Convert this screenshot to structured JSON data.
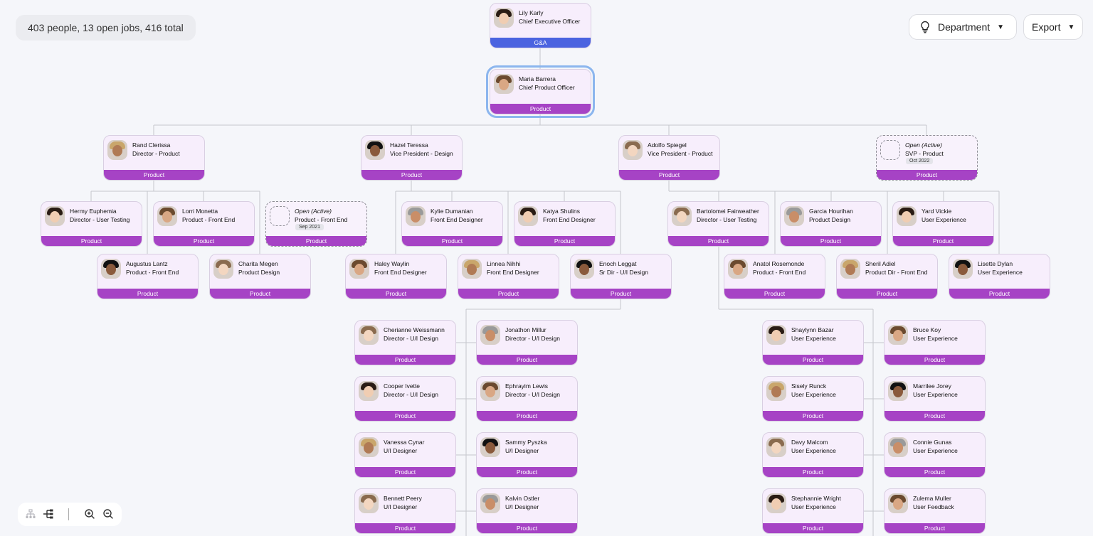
{
  "summary": "403 people, 13 open jobs, 416 total",
  "controls": {
    "department_label": "Department",
    "department_icon": "lightbulb-icon",
    "export_label": "Export"
  },
  "colors": {
    "product": "#a643c5",
    "ga": "#4b63e0"
  },
  "cards": [
    {
      "name": "Lily Karly",
      "title": "Chief Executive Officer",
      "dept": "G&A"
    },
    {
      "name": "Maria Barrera",
      "title": "Chief Product Officer",
      "dept": "Product"
    },
    {
      "name": "Rand Clerissa",
      "title": "Director - Product",
      "dept": "Product"
    },
    {
      "name": "Hazel Teressa",
      "title": "Vice President - Design",
      "dept": "Product"
    },
    {
      "name": "Adolfo Spiegel",
      "title": "Vice President - Product",
      "dept": "Product"
    },
    {
      "name": "Open (Active)",
      "title": "SVP - Product",
      "dept": "Product",
      "date": "Oct 2022"
    },
    {
      "name": "Hermy Euphemia",
      "title": "Director - User Testing",
      "dept": "Product"
    },
    {
      "name": "Lorri Monetta",
      "title": "Product - Front End",
      "dept": "Product"
    },
    {
      "name": "Open (Active)",
      "title": "Product - Front End",
      "dept": "Product",
      "date": "Sep 2021"
    },
    {
      "name": "Augustus Lantz",
      "title": "Product - Front End",
      "dept": "Product"
    },
    {
      "name": "Charita Megen",
      "title": "Product Design",
      "dept": "Product"
    },
    {
      "name": "Kylie Dumanian",
      "title": "Front End Designer",
      "dept": "Product"
    },
    {
      "name": "Katya Shulins",
      "title": "Front End Designer",
      "dept": "Product"
    },
    {
      "name": "Haley Waylin",
      "title": "Front End Designer",
      "dept": "Product"
    },
    {
      "name": "Linnea Nihhi",
      "title": "Front End Designer",
      "dept": "Product"
    },
    {
      "name": "Enoch Leggat",
      "title": "Sr Dir - U/I Design",
      "dept": "Product"
    },
    {
      "name": "Bartolomei Fairweather",
      "title": "Director - User Testing",
      "dept": "Product"
    },
    {
      "name": "Garcia Hourihan",
      "title": "Product Design",
      "dept": "Product"
    },
    {
      "name": "Yard Vickie",
      "title": "User Experience",
      "dept": "Product"
    },
    {
      "name": "Anatol Rosemonde",
      "title": "Product - Front End",
      "dept": "Product"
    },
    {
      "name": "Sheril Adiel",
      "title": "Product Dir - Front End",
      "dept": "Product"
    },
    {
      "name": "Lisette Dylan",
      "title": "User Experience",
      "dept": "Product"
    },
    {
      "name": "Cherianne Weissmann",
      "title": "Director - U/I Design",
      "dept": "Product"
    },
    {
      "name": "Jonathon Millur",
      "title": "Director - U/I Design",
      "dept": "Product"
    },
    {
      "name": "Cooper Ivette",
      "title": "Director - U/I Design",
      "dept": "Product"
    },
    {
      "name": "Ephrayim Lewis",
      "title": "Director - U/I Design",
      "dept": "Product"
    },
    {
      "name": "Vanessa Cynar",
      "title": "U/I Designer",
      "dept": "Product"
    },
    {
      "name": "Sammy Pyszka",
      "title": "U/I Designer",
      "dept": "Product"
    },
    {
      "name": "Bennett Peery",
      "title": "U/I Designer",
      "dept": "Product"
    },
    {
      "name": "Kalvin Ostler",
      "title": "U/I Designer",
      "dept": "Product"
    },
    {
      "name": "Shaylynn Bazar",
      "title": "User Experience",
      "dept": "Product"
    },
    {
      "name": "Bruce Koy",
      "title": "User Experience",
      "dept": "Product"
    },
    {
      "name": "Sisely Runck",
      "title": "User Experience",
      "dept": "Product"
    },
    {
      "name": "Marrilee Jorey",
      "title": "User Experience",
      "dept": "Product"
    },
    {
      "name": "Davy Malcom",
      "title": "User Experience",
      "dept": "Product"
    },
    {
      "name": "Connie Gunas",
      "title": "User Experience",
      "dept": "Product"
    },
    {
      "name": "Stephannie Wright",
      "title": "User Experience",
      "dept": "Product"
    },
    {
      "name": "Zulema Muller",
      "title": "User Feedback",
      "dept": "Product"
    }
  ]
}
